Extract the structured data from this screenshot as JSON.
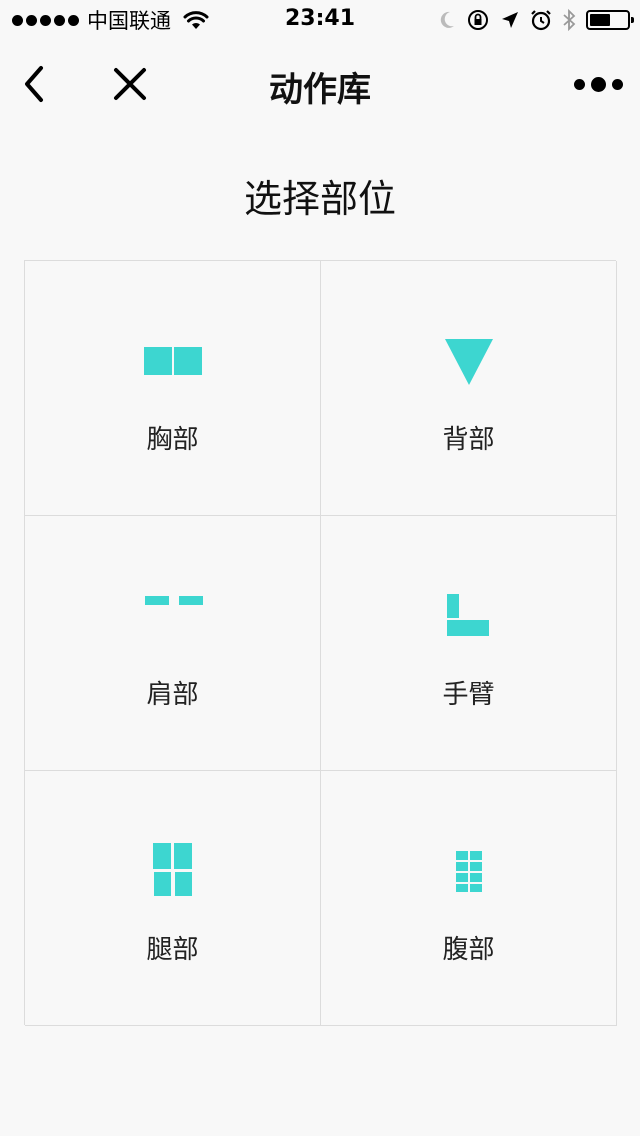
{
  "status_bar": {
    "carrier": "中国联通",
    "time": "23:41",
    "battery_level": 0.55
  },
  "nav": {
    "title": "动作库"
  },
  "section": {
    "title": "选择部位"
  },
  "body_parts": [
    {
      "label": "胸部",
      "icon": "chest-icon"
    },
    {
      "label": "背部",
      "icon": "back-icon"
    },
    {
      "label": "肩部",
      "icon": "shoulder-icon"
    },
    {
      "label": "手臂",
      "icon": "arm-icon"
    },
    {
      "label": "腿部",
      "icon": "leg-icon"
    },
    {
      "label": "腹部",
      "icon": "abs-icon"
    }
  ],
  "colors": {
    "accent": "#3dd6d0",
    "background": "#f8f8f8",
    "grid_line": "#dcdcdc"
  }
}
